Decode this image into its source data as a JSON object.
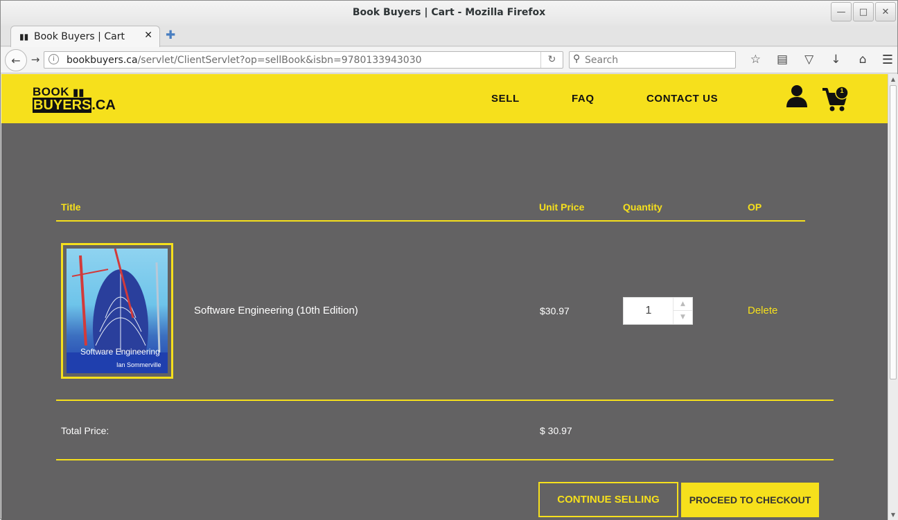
{
  "window": {
    "title": "Book Buyers | Cart - Mozilla Firefox",
    "controls": [
      "minimize-icon",
      "maximize-icon",
      "close-icon"
    ]
  },
  "tab": {
    "label": "Book Buyers | Cart",
    "close": "✕",
    "new_tab": "✚"
  },
  "navigation": {
    "url_host": "bookbuyers.ca",
    "url_path": "/servlet/ClientServlet?op=sellBook&isbn=9780133943030",
    "search_placeholder": "Search"
  },
  "site": {
    "logo_line1": "BOOK",
    "logo_line2_main": "BUYERS",
    "logo_line2_suffix": ".CA",
    "nav": {
      "sell": "SELL",
      "faq": "FAQ",
      "contact": "CONTACT US"
    },
    "cart_count": "1"
  },
  "cart": {
    "headers": {
      "title": "Title",
      "unit_price": "Unit Price",
      "quantity": "Quantity",
      "op": "OP"
    },
    "item": {
      "title": "Software Engineering (10th Edition)",
      "cover_title": "Software Engineering",
      "cover_author": "Ian Sommerville",
      "unit_price": "$30.97",
      "quantity": "1",
      "action": "Delete"
    },
    "total_label": "Total Price:",
    "total_value": "$ 30.97",
    "continue_button": "CONTINUE SELLING",
    "checkout_button": "PROCEED TO CHECKOUT"
  },
  "colors": {
    "accent": "#f6e01c",
    "page_bg": "#636263"
  }
}
